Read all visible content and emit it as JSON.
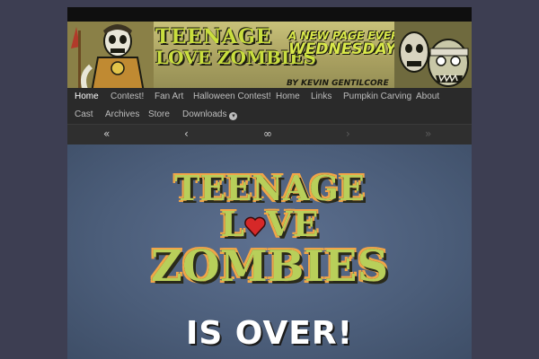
{
  "banner": {
    "logo_line1": "TEENAGE",
    "logo_line2": "LOVE ZOMBIES",
    "tagline_line1": "A NEW PAGE EVERY",
    "tagline_line2": "WEDNESDAY",
    "byline": "BY KEVIN GENTILCORE"
  },
  "nav": {
    "row1": [
      "Home",
      "Contest!",
      "Fan Art",
      "Halloween Contest!",
      "Home",
      "Links",
      "Pumpkin Carving",
      "About"
    ],
    "row2": [
      "Cast",
      "Archives",
      "Store",
      "Downloads"
    ],
    "active": "Home"
  },
  "pager": {
    "first": "«",
    "prev": "‹",
    "random": "∞",
    "next": "›",
    "last": "»"
  },
  "comic": {
    "title_line1": "TEENAGE",
    "title_line2_left": "L",
    "title_line2_right": "VE",
    "title_line3": "ZOMBIES",
    "subtitle": "IS OVER!"
  },
  "colors": {
    "background": "#3d3e52",
    "nav_bg": "#2a2a2a",
    "comic_bg": "#4b5d79",
    "logo_green": "#b8cf5a",
    "heart_red": "#d62828"
  }
}
